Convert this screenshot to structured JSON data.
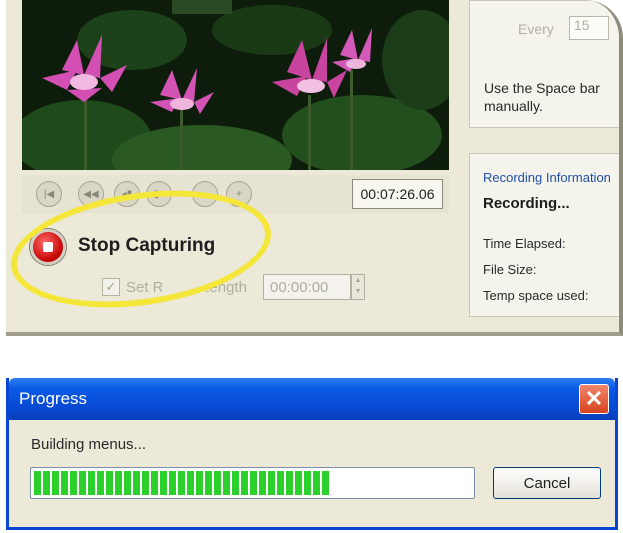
{
  "capture": {
    "timecode": "00:07:26.06",
    "stop_label": "Stop Capturing",
    "set_range_label": "Set Range Length",
    "range_time": "00:00:00",
    "transport_icons": [
      "prev-icon",
      "rewind-icon",
      "step-back-icon",
      "step-forward-icon",
      "minus-icon",
      "plus-icon"
    ]
  },
  "schedule": {
    "every_label": "Every",
    "every_value": "15",
    "space_hint": "Use the Space bar manually."
  },
  "recording_info": {
    "title": "Recording Information",
    "status": "Recording...",
    "time_elapsed_label": "Time Elapsed:",
    "file_size_label": "File Size:",
    "temp_space_label": "Temp space used:"
  },
  "progress_dialog": {
    "title": "Progress",
    "status": "Building menus...",
    "progress_fraction": 0.68,
    "cancel_label": "Cancel"
  },
  "colors": {
    "accent_blue": "#0a46d6",
    "progress_green": "#2bd02b",
    "highlight_yellow": "#f5e63a",
    "stop_red": "#c40000"
  }
}
